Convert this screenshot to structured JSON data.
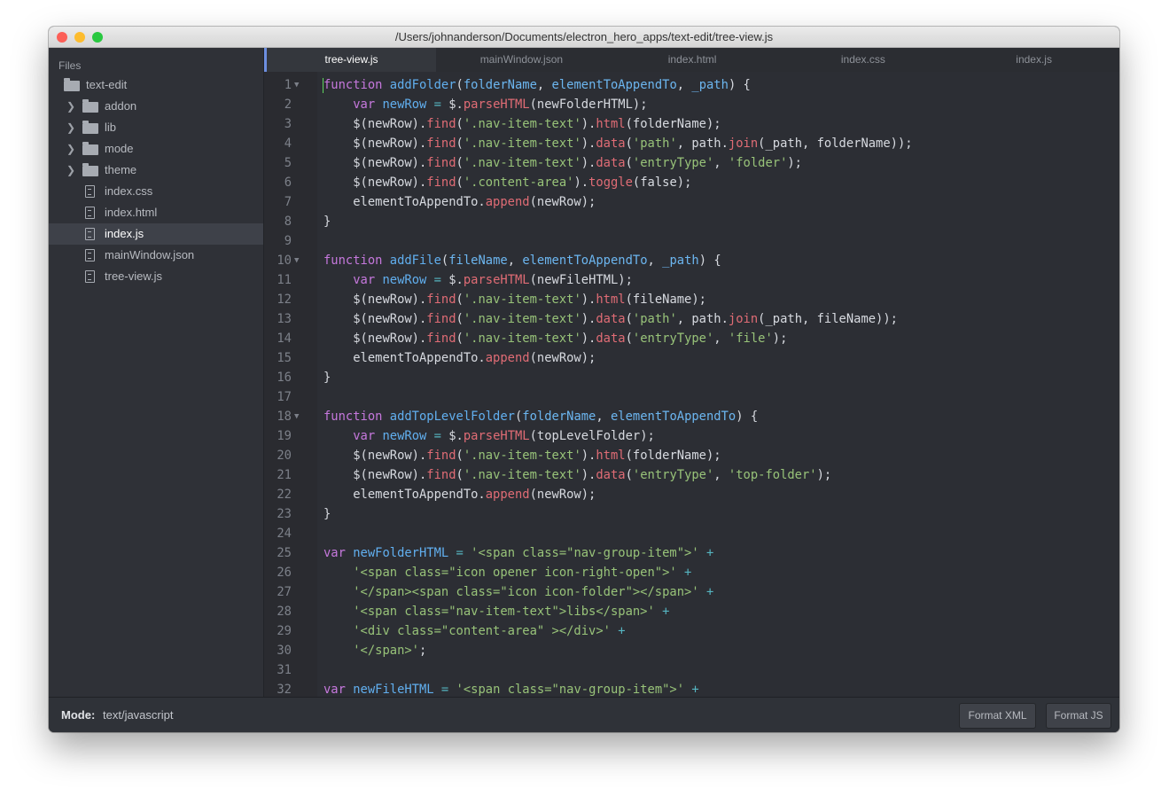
{
  "window": {
    "title": "/Users/johnanderson/Documents/electron_hero_apps/text-edit/tree-view.js"
  },
  "sidebar": {
    "heading": "Files",
    "root": "text-edit",
    "items": [
      {
        "label": "addon",
        "type": "folder"
      },
      {
        "label": "lib",
        "type": "folder"
      },
      {
        "label": "mode",
        "type": "folder"
      },
      {
        "label": "theme",
        "type": "folder"
      },
      {
        "label": "index.css",
        "type": "file"
      },
      {
        "label": "index.html",
        "type": "file"
      },
      {
        "label": "index.js",
        "type": "file",
        "selected": true
      },
      {
        "label": "mainWindow.json",
        "type": "file"
      },
      {
        "label": "tree-view.js",
        "type": "file"
      }
    ]
  },
  "tabs": [
    {
      "label": "tree-view.js",
      "active": true
    },
    {
      "label": "mainWindow.json"
    },
    {
      "label": "index.html"
    },
    {
      "label": "index.css"
    },
    {
      "label": "index.js"
    }
  ],
  "editor": {
    "folds": [
      1,
      10,
      18
    ],
    "lines": [
      [
        [
          "k",
          "function"
        ],
        " ",
        [
          "f",
          "addFolder"
        ],
        "(",
        [
          "p",
          "folderName"
        ],
        ", ",
        [
          "p",
          "elementToAppendTo"
        ],
        ", ",
        [
          "p",
          "_path"
        ],
        ") {"
      ],
      [
        "    ",
        [
          "k",
          "var"
        ],
        " ",
        [
          "f",
          "newRow"
        ],
        " ",
        [
          "o",
          "="
        ],
        " $.",
        [
          "m",
          "parseHTML"
        ],
        "(newFolderHTML);"
      ],
      [
        "    $(newRow).",
        [
          "m",
          "find"
        ],
        "(",
        [
          "s",
          "'.nav-item-text'"
        ],
        ").",
        [
          "m",
          "html"
        ],
        "(folderName);"
      ],
      [
        "    $(newRow).",
        [
          "m",
          "find"
        ],
        "(",
        [
          "s",
          "'.nav-item-text'"
        ],
        ").",
        [
          "m",
          "data"
        ],
        "(",
        [
          "s",
          "'path'"
        ],
        ", path.",
        [
          "m",
          "join"
        ],
        "(_path, folderName));"
      ],
      [
        "    $(newRow).",
        [
          "m",
          "find"
        ],
        "(",
        [
          "s",
          "'.nav-item-text'"
        ],
        ").",
        [
          "m",
          "data"
        ],
        "(",
        [
          "s",
          "'entryType'"
        ],
        ", ",
        [
          "s",
          "'folder'"
        ],
        ");"
      ],
      [
        "    $(newRow).",
        [
          "m",
          "find"
        ],
        "(",
        [
          "s",
          "'.content-area'"
        ],
        ").",
        [
          "m",
          "toggle"
        ],
        "(false);"
      ],
      [
        "    elementToAppendTo.",
        [
          "m",
          "append"
        ],
        "(newRow);"
      ],
      [
        "}"
      ],
      [],
      [
        [
          "k",
          "function"
        ],
        " ",
        [
          "f",
          "addFile"
        ],
        "(",
        [
          "p",
          "fileName"
        ],
        ", ",
        [
          "p",
          "elementToAppendTo"
        ],
        ", ",
        [
          "p",
          "_path"
        ],
        ") {"
      ],
      [
        "    ",
        [
          "k",
          "var"
        ],
        " ",
        [
          "f",
          "newRow"
        ],
        " ",
        [
          "o",
          "="
        ],
        " $.",
        [
          "m",
          "parseHTML"
        ],
        "(newFileHTML);"
      ],
      [
        "    $(newRow).",
        [
          "m",
          "find"
        ],
        "(",
        [
          "s",
          "'.nav-item-text'"
        ],
        ").",
        [
          "m",
          "html"
        ],
        "(fileName);"
      ],
      [
        "    $(newRow).",
        [
          "m",
          "find"
        ],
        "(",
        [
          "s",
          "'.nav-item-text'"
        ],
        ").",
        [
          "m",
          "data"
        ],
        "(",
        [
          "s",
          "'path'"
        ],
        ", path.",
        [
          "m",
          "join"
        ],
        "(_path, fileName));"
      ],
      [
        "    $(newRow).",
        [
          "m",
          "find"
        ],
        "(",
        [
          "s",
          "'.nav-item-text'"
        ],
        ").",
        [
          "m",
          "data"
        ],
        "(",
        [
          "s",
          "'entryType'"
        ],
        ", ",
        [
          "s",
          "'file'"
        ],
        ");"
      ],
      [
        "    elementToAppendTo.",
        [
          "m",
          "append"
        ],
        "(newRow);"
      ],
      [
        "}"
      ],
      [],
      [
        [
          "k",
          "function"
        ],
        " ",
        [
          "f",
          "addTopLevelFolder"
        ],
        "(",
        [
          "p",
          "folderName"
        ],
        ", ",
        [
          "p",
          "elementToAppendTo"
        ],
        ") {"
      ],
      [
        "    ",
        [
          "k",
          "var"
        ],
        " ",
        [
          "f",
          "newRow"
        ],
        " ",
        [
          "o",
          "="
        ],
        " $.",
        [
          "m",
          "parseHTML"
        ],
        "(topLevelFolder);"
      ],
      [
        "    $(newRow).",
        [
          "m",
          "find"
        ],
        "(",
        [
          "s",
          "'.nav-item-text'"
        ],
        ").",
        [
          "m",
          "html"
        ],
        "(folderName);"
      ],
      [
        "    $(newRow).",
        [
          "m",
          "find"
        ],
        "(",
        [
          "s",
          "'.nav-item-text'"
        ],
        ").",
        [
          "m",
          "data"
        ],
        "(",
        [
          "s",
          "'entryType'"
        ],
        ", ",
        [
          "s",
          "'top-folder'"
        ],
        ");"
      ],
      [
        "    elementToAppendTo.",
        [
          "m",
          "append"
        ],
        "(newRow);"
      ],
      [
        "}"
      ],
      [],
      [
        [
          "k",
          "var"
        ],
        " ",
        [
          "f",
          "newFolderHTML"
        ],
        " ",
        [
          "o",
          "="
        ],
        " ",
        [
          "s",
          "'<span class=\"nav-group-item\">'"
        ],
        " ",
        [
          "o",
          "+"
        ]
      ],
      [
        "    ",
        [
          "s",
          "'<span class=\"icon opener icon-right-open\">'"
        ],
        " ",
        [
          "o",
          "+"
        ]
      ],
      [
        "    ",
        [
          "s",
          "'</span><span class=\"icon icon-folder\"></span>'"
        ],
        " ",
        [
          "o",
          "+"
        ]
      ],
      [
        "    ",
        [
          "s",
          "'<span class=\"nav-item-text\">libs</span>'"
        ],
        " ",
        [
          "o",
          "+"
        ]
      ],
      [
        "    ",
        [
          "s",
          "'<div class=\"content-area\" ></div>'"
        ],
        " ",
        [
          "o",
          "+"
        ]
      ],
      [
        "    ",
        [
          "s",
          "'</span>'"
        ],
        ";"
      ],
      [],
      [
        [
          "k",
          "var"
        ],
        " ",
        [
          "f",
          "newFileHTML"
        ],
        " ",
        [
          "o",
          "="
        ],
        " ",
        [
          "s",
          "'<span class=\"nav-group-item\">'"
        ],
        " ",
        [
          "o",
          "+"
        ]
      ]
    ]
  },
  "status": {
    "mode_label": "Mode:",
    "mode_value": "text/javascript",
    "format_xml": "Format XML",
    "format_js": "Format JS"
  },
  "colors": {
    "keyword": "#c678dd",
    "function": "#61afef",
    "string": "#98c379",
    "method": "#e06c75",
    "accent": "#6d8fe0"
  }
}
